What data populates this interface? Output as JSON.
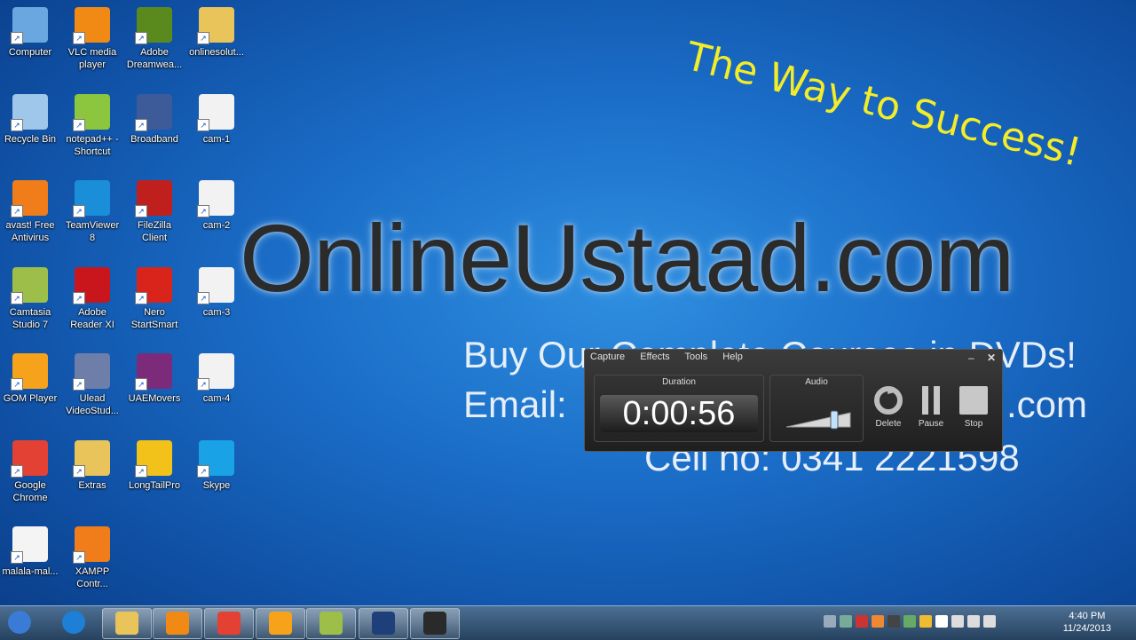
{
  "desktop": {
    "icons": [
      {
        "label": "Computer",
        "color": "#6aa7e0"
      },
      {
        "label": "VLC media player",
        "color": "#f08a14"
      },
      {
        "label": "Adobe Dreamwea...",
        "color": "#5a8a1e"
      },
      {
        "label": "onlinesolut...",
        "color": "#e8c45a"
      },
      {
        "label": "Recycle Bin",
        "color": "#9ec7ea"
      },
      {
        "label": "notepad++ - Shortcut",
        "color": "#8cc63f"
      },
      {
        "label": "Broadband",
        "color": "#3d5a99"
      },
      {
        "label": "cam-1",
        "color": "#f2f2f2"
      },
      {
        "label": "avast! Free Antivirus",
        "color": "#f07d1a"
      },
      {
        "label": "TeamViewer 8",
        "color": "#1a8ed8"
      },
      {
        "label": "FileZilla Client",
        "color": "#c0201d"
      },
      {
        "label": "cam-2",
        "color": "#f2f2f2"
      },
      {
        "label": "Camtasia Studio 7",
        "color": "#9dbf4a"
      },
      {
        "label": "Adobe Reader XI",
        "color": "#c9161c"
      },
      {
        "label": "Nero StartSmart",
        "color": "#d8241b"
      },
      {
        "label": "cam-3",
        "color": "#f2f2f2"
      },
      {
        "label": "GOM Player",
        "color": "#f6a21a"
      },
      {
        "label": "Ulead VideoStud...",
        "color": "#6d7fa8"
      },
      {
        "label": "UAEMovers",
        "color": "#7b2b7a"
      },
      {
        "label": "cam-4",
        "color": "#f2f2f2"
      },
      {
        "label": "Google Chrome",
        "color": "#e34133"
      },
      {
        "label": "Extras",
        "color": "#e8c45a"
      },
      {
        "label": "LongTailPro",
        "color": "#f3c21a"
      },
      {
        "label": "Skype",
        "color": "#19a3e6"
      },
      {
        "label": "malala-mal...",
        "color": "#f4f4f4"
      },
      {
        "label": "XAMPP Contr...",
        "color": "#f07d1a"
      }
    ]
  },
  "wallpaper": {
    "tagline": "The Way to Success!",
    "brand": "OnlineUstaad.com",
    "line1": "Buy Our Complete Courses in DVDs!",
    "line2": "Email:",
    "line2_end": ".com",
    "line3": "Cell no: 0341 2221598"
  },
  "recorder": {
    "menu": [
      "Capture",
      "Effects",
      "Tools",
      "Help"
    ],
    "minimize": "–",
    "close": "✕",
    "duration_label": "Duration",
    "duration": "0:00:56",
    "audio_label": "Audio",
    "audio_level": 0.75,
    "delete_label": "Delete",
    "pause_label": "Pause",
    "stop_label": "Stop"
  },
  "taskbar": {
    "time": "4:40 PM",
    "date": "11/24/2013",
    "apps": [
      {
        "name": "start",
        "color": "#3a7bd5"
      },
      {
        "name": "internet-explorer",
        "color": "#1e7fd6"
      },
      {
        "name": "explorer",
        "color": "#e8c45a"
      },
      {
        "name": "media-player",
        "color": "#f08a14"
      },
      {
        "name": "chrome",
        "color": "#e34133"
      },
      {
        "name": "gom-player",
        "color": "#f6a21a"
      },
      {
        "name": "camtasia",
        "color": "#9dbf4a"
      },
      {
        "name": "photoshop",
        "color": "#1f3f7a"
      },
      {
        "name": "camtasia-recorder",
        "color": "#2a2a2a"
      }
    ]
  }
}
